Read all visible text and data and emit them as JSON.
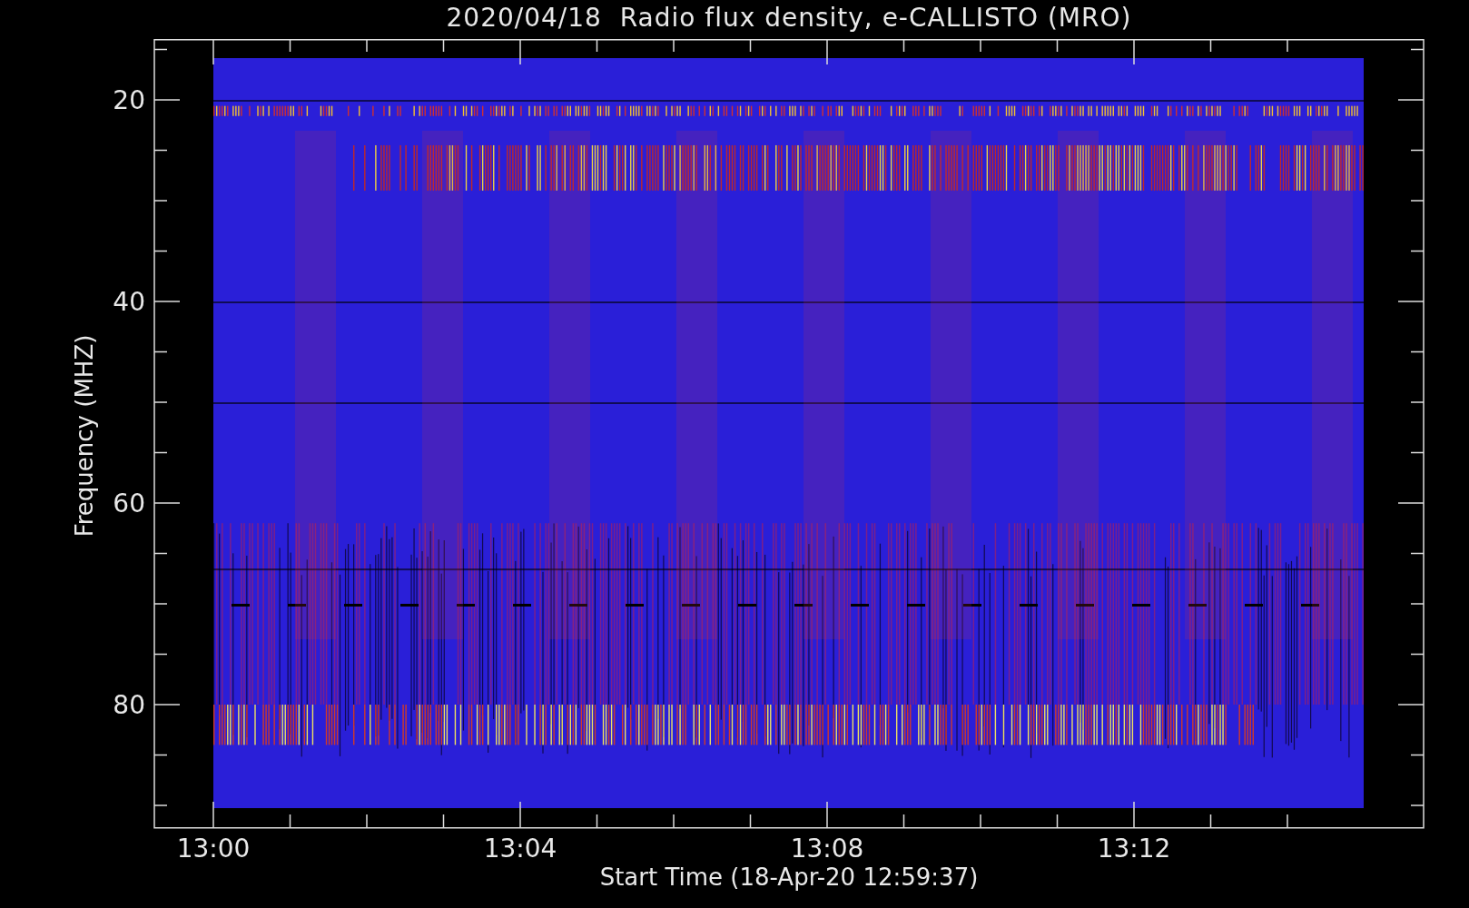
{
  "title": "2020/04/18  Radio flux density, e-CALLISTO (MRO)",
  "plot": {
    "xlabel": "Start Time (18-Apr-20 12:59:37)",
    "ylabel": "Frequency (MHZ)",
    "xticks": [
      "13:00",
      "13:04",
      "13:08",
      "13:12"
    ],
    "yticks": [
      "20",
      "40",
      "60",
      "80"
    ]
  }
}
